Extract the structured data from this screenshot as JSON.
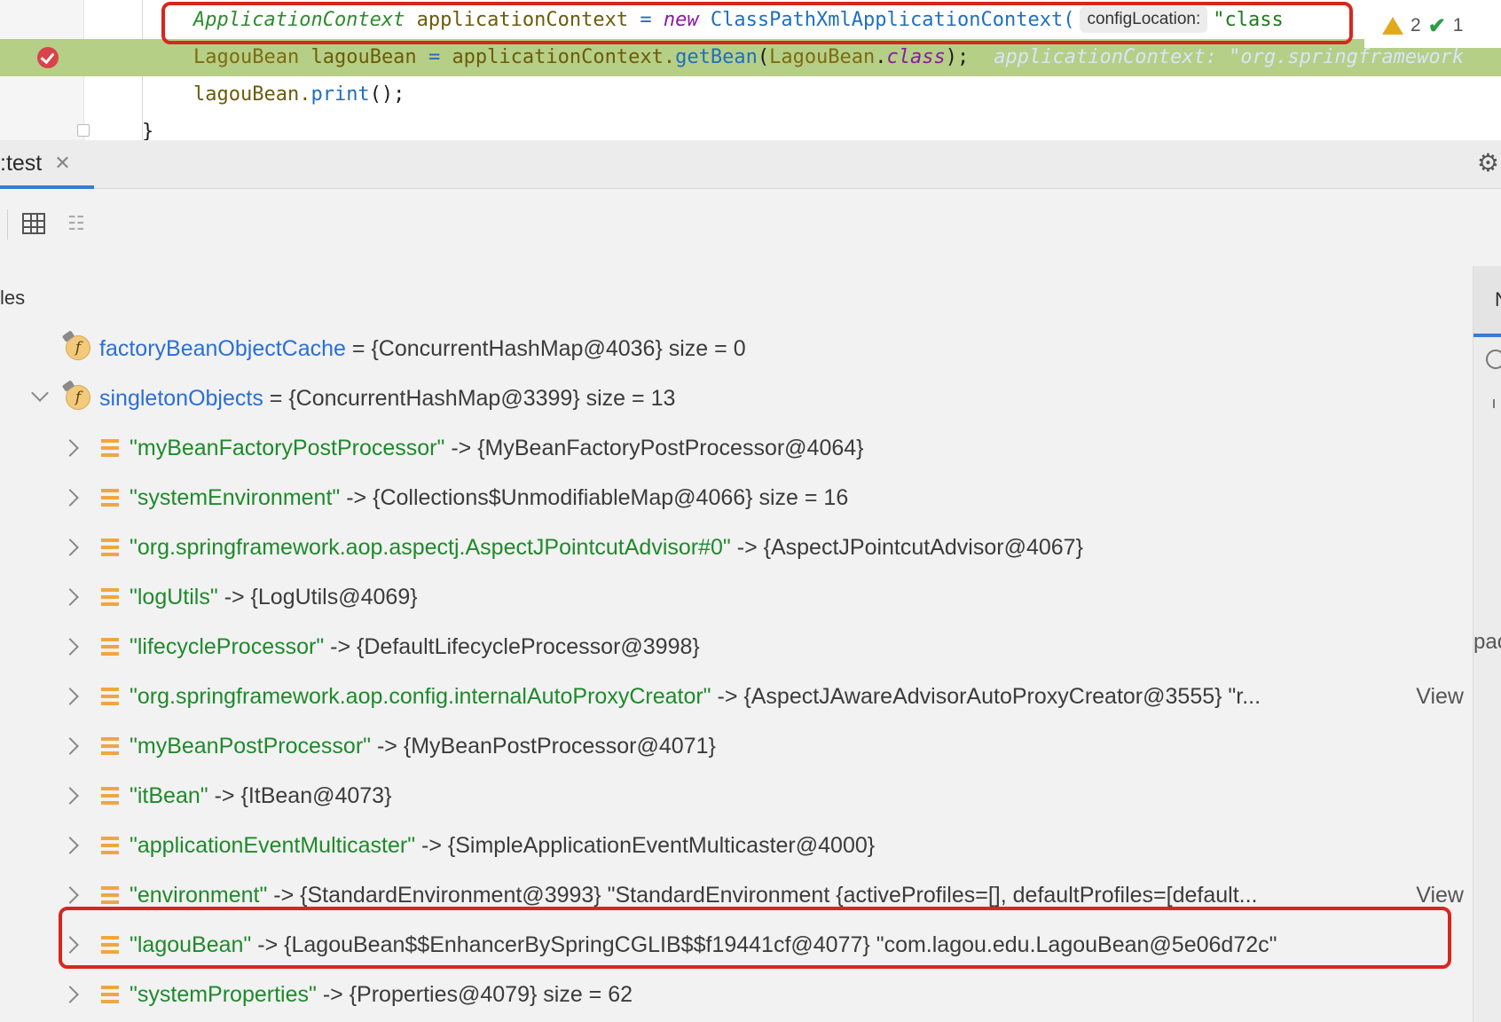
{
  "editor": {
    "line1": {
      "type": "ApplicationContext",
      "var": "applicationContext",
      "eq": "=",
      "new_kw": "new",
      "cls": "ClassPathXmlApplicationContext(",
      "inlay": "configLocation:",
      "str": "\"class"
    },
    "line2": {
      "type": "LagouBean",
      "var": "lagouBean",
      "eq": "=",
      "obj": "applicationContext.",
      "meth": "getBean",
      "paren_open": "(",
      "arg": "LagouBean",
      "dot": ".",
      "kw": "class",
      "end": ");",
      "hint": "applicationContext: \"org.springframework"
    },
    "line3": {
      "var": "lagouBean.",
      "meth": "print",
      "end": "();"
    },
    "line4": "}",
    "inspection": {
      "warnings": "2",
      "ok": "1"
    }
  },
  "debug": {
    "tab_label": ":test",
    "tab_close": "✕",
    "vars_label": "les",
    "right_tab_label": "N",
    "right_cut": "pac"
  },
  "tree": [
    {
      "name": "factoryBeanObjectCache",
      "rest": "= {ConcurrentHashMap@4036}  size = 0",
      "kind": "field",
      "chevron": "none"
    },
    {
      "name": "singletonObjects",
      "rest": "= {ConcurrentHashMap@3399}  size = 13",
      "kind": "field",
      "chevron": "down"
    },
    {
      "key": "\"myBeanFactoryPostProcessor\"",
      "rest": "-> {MyBeanFactoryPostProcessor@4064}",
      "kind": "entry",
      "chevron": "right"
    },
    {
      "key": "\"systemEnvironment\"",
      "rest": "-> {Collections$UnmodifiableMap@4066}  size = 16",
      "kind": "entry",
      "chevron": "right"
    },
    {
      "key": "\"org.springframework.aop.aspectj.AspectJPointcutAdvisor#0\"",
      "rest": "-> {AspectJPointcutAdvisor@4067}",
      "kind": "entry",
      "chevron": "right"
    },
    {
      "key": "\"logUtils\"",
      "rest": "-> {LogUtils@4069}",
      "kind": "entry",
      "chevron": "right"
    },
    {
      "key": "\"lifecycleProcessor\"",
      "rest": "-> {DefaultLifecycleProcessor@3998}",
      "kind": "entry",
      "chevron": "right"
    },
    {
      "key": "\"org.springframework.aop.config.internalAutoProxyCreator\"",
      "rest": "-> {AspectJAwareAdvisorAutoProxyCreator@3555} \"r...",
      "kind": "entry",
      "chevron": "right",
      "view": "View"
    },
    {
      "key": "\"myBeanPostProcessor\"",
      "rest": "-> {MyBeanPostProcessor@4071}",
      "kind": "entry",
      "chevron": "right"
    },
    {
      "key": "\"itBean\"",
      "rest": "-> {ItBean@4073}",
      "kind": "entry",
      "chevron": "right"
    },
    {
      "key": "\"applicationEventMulticaster\"",
      "rest": "-> {SimpleApplicationEventMulticaster@4000}",
      "kind": "entry",
      "chevron": "right"
    },
    {
      "key": "\"environment\"",
      "rest": "-> {StandardEnvironment@3993} \"StandardEnvironment {activeProfiles=[], defaultProfiles=[default...",
      "kind": "entry",
      "chevron": "right",
      "view": "View"
    },
    {
      "key": "\"lagouBean\"",
      "rest": "-> {LagouBean$$EnhancerBySpringCGLIB$$f19441cf@4077} \"com.lagou.edu.LagouBean@5e06d72c\"",
      "kind": "entry",
      "chevron": "right"
    },
    {
      "key": "\"systemProperties\"",
      "rest": "-> {Properties@4079}  size = 62",
      "kind": "entry",
      "chevron": "right"
    }
  ],
  "colors": {
    "highlight_line": "#b5cf86",
    "annotation_box": "#d9261c",
    "field_name": "#2a6fd6",
    "entry_key": "#1e8a2b",
    "tab_underline": "#3a7bd5"
  }
}
